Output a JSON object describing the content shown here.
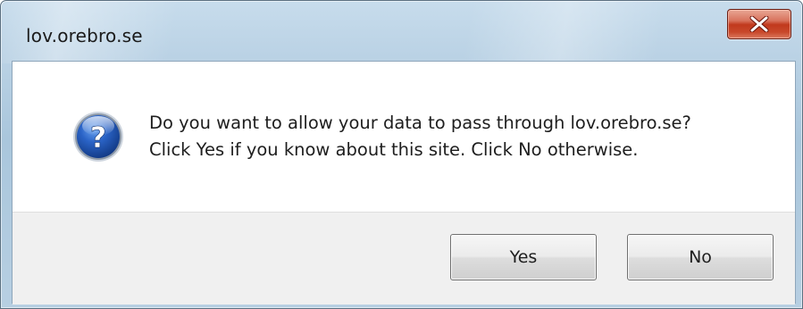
{
  "window": {
    "title": "lov.orebro.se"
  },
  "dialog": {
    "icon": "question-icon",
    "message_line1": "Do you want to allow your data to pass through lov.orebro.se?",
    "message_line2": "Click Yes if you know about this site. Click No otherwise."
  },
  "buttons": {
    "yes_label": "Yes",
    "no_label": "No",
    "close_icon": "close-icon"
  },
  "colors": {
    "frame": "#b9d1e4",
    "close_button": "#c8482b",
    "footer": "#f0f0f0",
    "icon_blue": "#1f55b5"
  }
}
